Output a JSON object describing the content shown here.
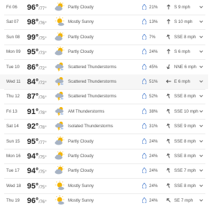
{
  "forecast": [
    {
      "day": "Fri 06",
      "high": "96°",
      "low": "/77°",
      "icon": "partly-cloudy-icon",
      "condition": "Partly Cloudy",
      "precip": "21%",
      "wind_dir": "S",
      "wind": "S 9 mph",
      "arrow_rot": 0
    },
    {
      "day": "Sat 07",
      "high": "98°",
      "low": "/76°",
      "icon": "mostly-sunny-icon",
      "condition": "Mostly Sunny",
      "precip": "13%",
      "wind_dir": "S",
      "wind": "S 10 mph",
      "arrow_rot": 0
    },
    {
      "day": "Sun 08",
      "high": "99°",
      "low": "/75°",
      "icon": "partly-cloudy-icon",
      "condition": "Partly Cloudy",
      "precip": "7%",
      "wind_dir": "SSE",
      "wind": "SSE 8 mph",
      "arrow_rot": -22
    },
    {
      "day": "Mon 09",
      "high": "95°",
      "low": "/73°",
      "icon": "partly-cloudy-icon",
      "condition": "Partly Cloudy",
      "precip": "24%",
      "wind_dir": "S",
      "wind": "S 6 mph",
      "arrow_rot": 0
    },
    {
      "day": "Tue 10",
      "high": "86°",
      "low": "/72°",
      "icon": "thunderstorm-icon",
      "condition": "Scattered Thunderstorms",
      "precip": "45%",
      "wind_dir": "NNE",
      "wind": "NNE 6 mph",
      "arrow_rot": 200
    },
    {
      "day": "Wed 11",
      "high": "84°",
      "low": "/72°",
      "icon": "thunderstorm-icon",
      "condition": "Scattered Thunderstorms",
      "precip": "51%",
      "wind_dir": "E",
      "wind": "E 6 mph",
      "arrow_rot": -90
    },
    {
      "day": "Thu 12",
      "high": "87°",
      "low": "/76°",
      "icon": "thunderstorm-icon",
      "condition": "Scattered Thunderstorms",
      "precip": "52%",
      "wind_dir": "SSE",
      "wind": "SSE 8 mph",
      "arrow_rot": -22
    },
    {
      "day": "Fri 13",
      "high": "91°",
      "low": "/78°",
      "icon": "thunderstorm-icon",
      "condition": "AM Thunderstorms",
      "precip": "38%",
      "wind_dir": "SSE",
      "wind": "SSE 10 mph",
      "arrow_rot": -22
    },
    {
      "day": "Sat 14",
      "high": "92°",
      "low": "/78°",
      "icon": "thunderstorm-icon",
      "condition": "Isolated Thunderstorms",
      "precip": "31%",
      "wind_dir": "SSE",
      "wind": "SSE 9 mph",
      "arrow_rot": -22
    },
    {
      "day": "Sun 15",
      "high": "95°",
      "low": "/77°",
      "icon": "partly-cloudy-icon",
      "condition": "Partly Cloudy",
      "precip": "24%",
      "wind_dir": "SSE",
      "wind": "SSE 8 mph",
      "arrow_rot": -22
    },
    {
      "day": "Mon 16",
      "high": "94°",
      "low": "/75°",
      "icon": "partly-cloudy-icon",
      "condition": "Partly Cloudy",
      "precip": "24%",
      "wind_dir": "SSE",
      "wind": "SSE 8 mph",
      "arrow_rot": -22
    },
    {
      "day": "Tue 17",
      "high": "94°",
      "low": "/75°",
      "icon": "partly-cloudy-icon",
      "condition": "Partly Cloudy",
      "precip": "24%",
      "wind_dir": "SSE",
      "wind": "SSE 7 mph",
      "arrow_rot": -22
    },
    {
      "day": "Wed 18",
      "high": "95°",
      "low": "/75°",
      "icon": "mostly-sunny-icon",
      "condition": "Mostly Sunny",
      "precip": "24%",
      "wind_dir": "SSE",
      "wind": "SSE 8 mph",
      "arrow_rot": -22
    },
    {
      "day": "Thu 19",
      "high": "96°",
      "low": "/76°",
      "icon": "mostly-sunny-icon",
      "condition": "Mostly Sunny",
      "precip": "24%",
      "wind_dir": "SE",
      "wind": "SE 7 mph",
      "arrow_rot": -45
    }
  ],
  "colors": {
    "sun": "#f4b400",
    "cloud": "#a7b3c4",
    "rain_drop": "#4a7fd0",
    "lightning": "#f4b400"
  }
}
